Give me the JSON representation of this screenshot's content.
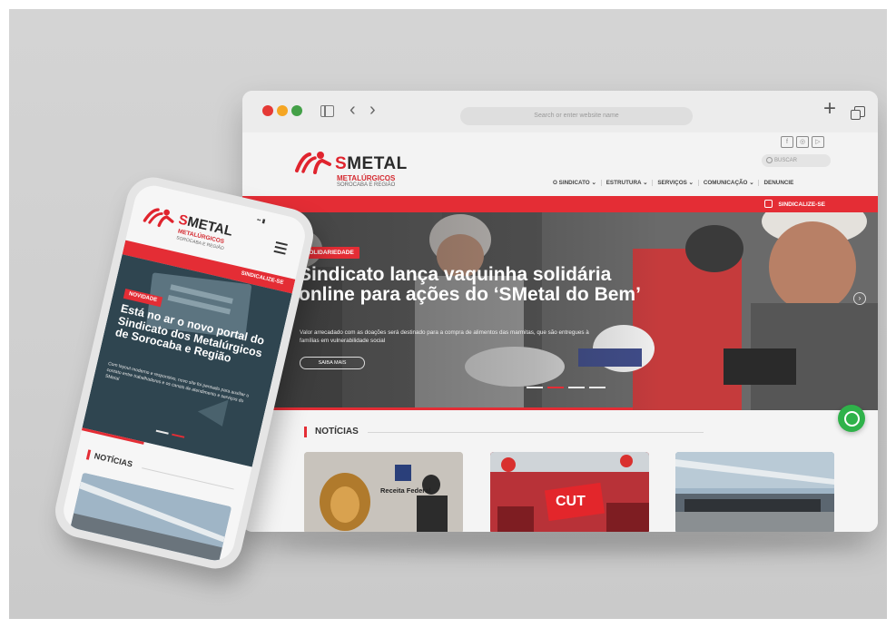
{
  "browser": {
    "url_placeholder": "Search or enter website name",
    "nav_back": "‹",
    "nav_forward": "›",
    "new_tab": "+"
  },
  "logo": {
    "name_prefix": "S",
    "name_main": "METAL",
    "line1": "METALÚRGICOS",
    "line2": "SOROCABA E REGIÃO"
  },
  "header": {
    "search_placeholder": "BUSCAR",
    "menu": [
      {
        "label": "O SINDICATO ⌄"
      },
      {
        "label": "ESTRUTURA ⌄"
      },
      {
        "label": "SERVIÇOS ⌄"
      },
      {
        "label": "COMUNICAÇÃO ⌄"
      },
      {
        "label": "DENUNCIE"
      }
    ],
    "cta": "SINDICALIZE-SE",
    "social_icons": [
      "facebook-icon",
      "instagram-icon",
      "youtube-icon"
    ]
  },
  "hero": {
    "tag": "SOLIDARIEDADE",
    "title": "Sindicato lança vaquinha solidária online para ações do ‘SMetal do Bem’",
    "description": "Valor arrecadado com as doações será destinado para a compra de alimentos das marmitas, que são entregues à famílias em vulnerabilidade social",
    "button": "SAIBA MAIS",
    "active_slide": 2,
    "slide_count": 4
  },
  "news": {
    "heading": "NOTÍCIAS",
    "cards": [
      {
        "caption": "Receita Federal"
      },
      {
        "caption": "CUT"
      },
      {
        "caption": ""
      }
    ]
  },
  "phone": {
    "cta": "SINDICALIZE-SE",
    "tag": "NOVIDADE",
    "title": "Está no ar o novo portal do Sindicato dos Metalúrgicos de Sorocaba e Região",
    "description": "Com layout moderno e responsivo, novo site foi pensado para auxiliar o contato entre trabalhadores e os canais de atendimento e serviços do SMetal",
    "news_heading": "NOTÍCIAS",
    "active_slide": 2,
    "slide_count": 2
  },
  "colors": {
    "brand_red": "#e42d35",
    "whatsapp_green": "#2fb24a"
  }
}
